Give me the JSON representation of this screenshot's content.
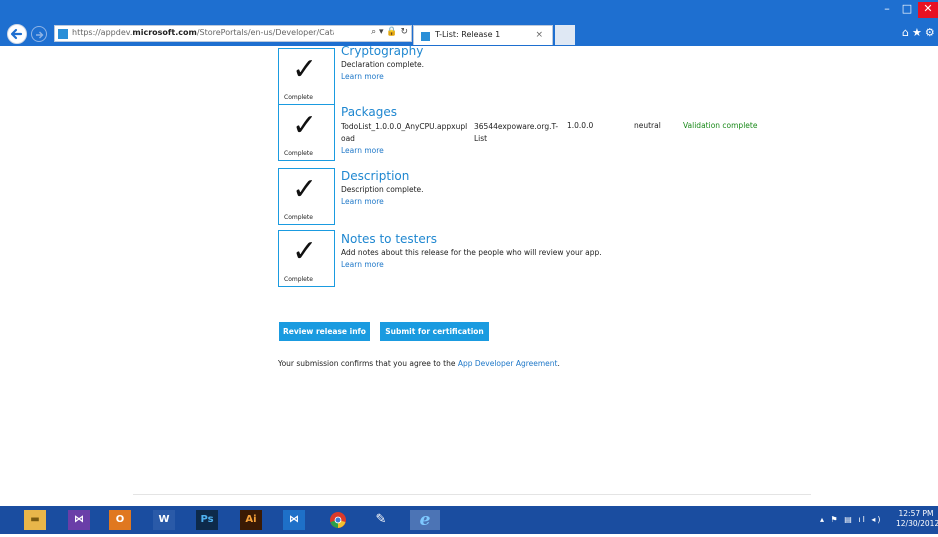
{
  "browser": {
    "url_prefix": "https://appdev.",
    "url_domain": "microsoft.com",
    "url_path": "/StorePortals/en-us/Developer/Catalog/ReleaseAr",
    "tab_title": "T-List: Release 1",
    "tab_close": "×",
    "address_icons": "⌕ ▾ 🔒 ↻"
  },
  "sections": [
    {
      "title": "Cryptography",
      "desc": "Declaration complete.",
      "link": "Learn more",
      "status": "Complete"
    },
    {
      "title": "Packages",
      "link": "Learn more",
      "status": "Complete"
    },
    {
      "title": "Description",
      "desc": "Description complete.",
      "link": "Learn more",
      "status": "Complete"
    },
    {
      "title": "Notes to testers",
      "desc": "Add notes about this release for the people who will review your app.",
      "link": "Learn more",
      "status": "Complete"
    }
  ],
  "package": {
    "file": "TodoList_1.0.0.0_AnyCPU.appxupload",
    "name": "36544expoware.org.T-List",
    "version": "1.0.0.0",
    "language": "neutral",
    "status": "Validation complete"
  },
  "actions": {
    "review": "Review release info",
    "submit": "Submit for certification"
  },
  "agreement": {
    "text": "Your submission confirms that you agree to the ",
    "link": "App Developer Agreement",
    "end": "."
  },
  "taskbar": {
    "time": "12:57 PM",
    "date": "12/30/2012"
  },
  "colors": {
    "accent": "#1a9be0",
    "link": "#1f78c8",
    "success": "#1a8a1a",
    "titlebar": "#1e6fd0",
    "taskbar": "#1a4da0"
  }
}
